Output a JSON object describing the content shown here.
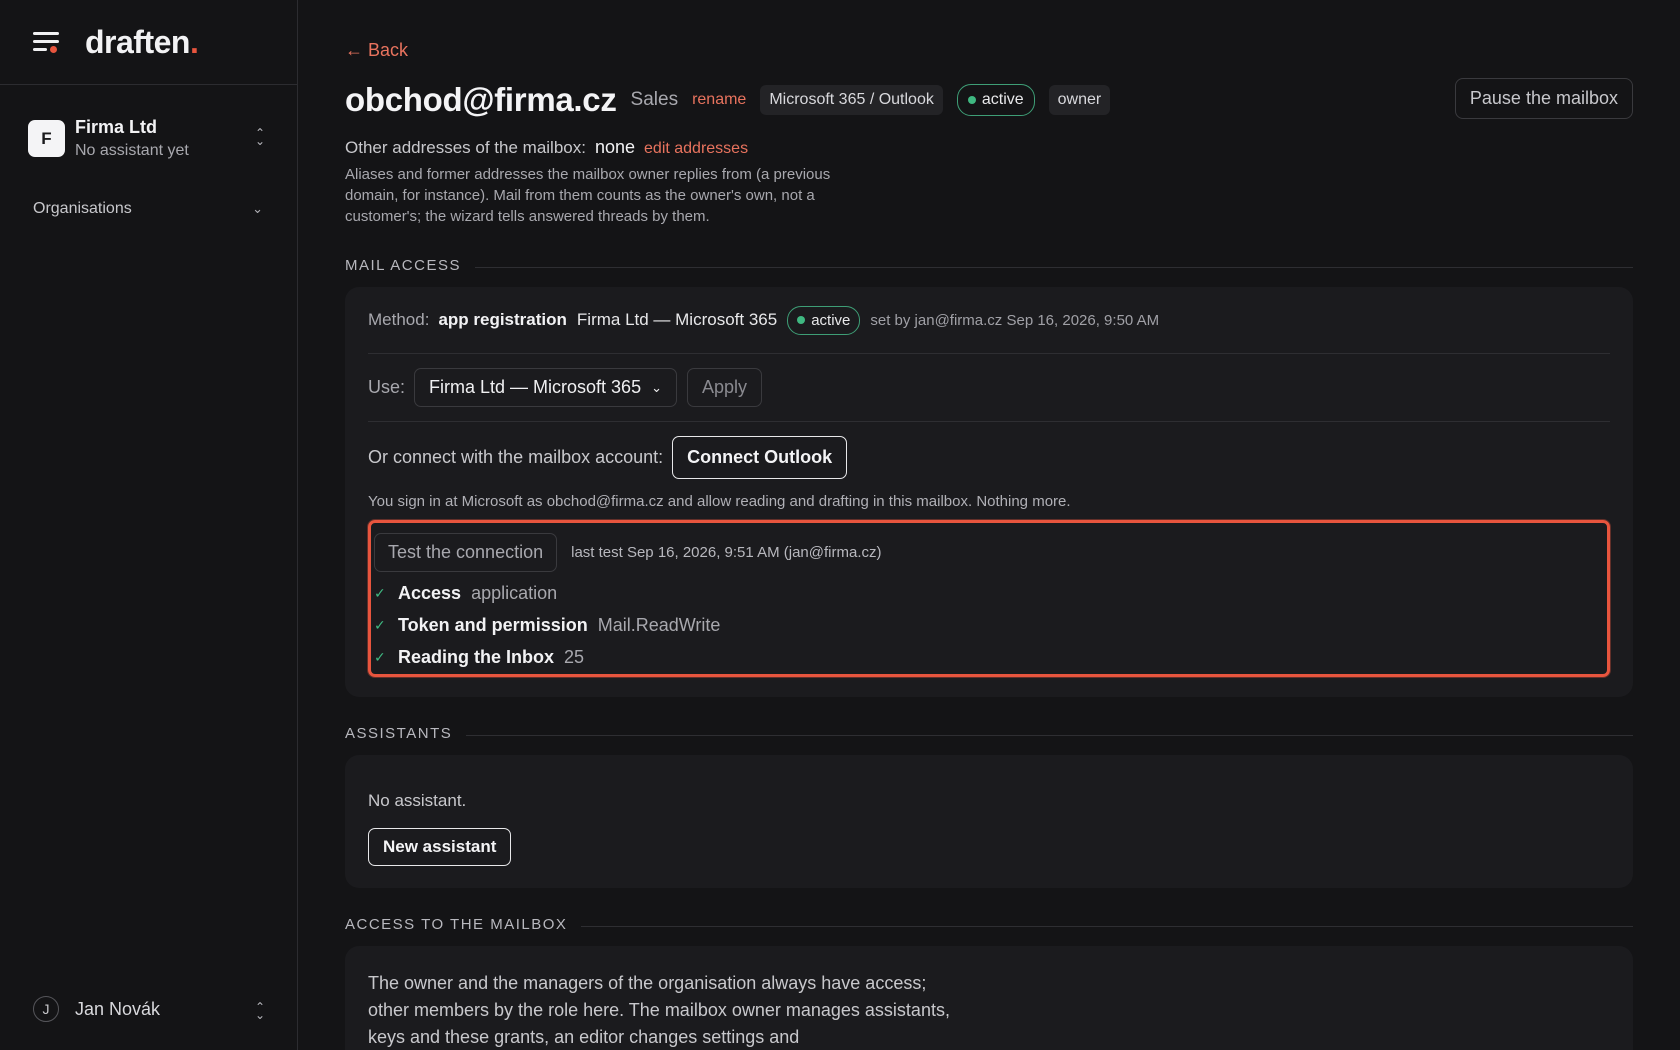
{
  "sidebar": {
    "logo": "draften",
    "logo_dot": ".",
    "org": {
      "initial": "F",
      "name": "Firma Ltd",
      "subtitle": "No assistant yet"
    },
    "organisations_label": "Organisations",
    "user": {
      "initial": "J",
      "name": "Jan Novák"
    }
  },
  "header": {
    "back_label": "← Back",
    "title": "obchod@firma.cz",
    "subtitle": "Sales",
    "rename_label": "rename",
    "provider_chip": "Microsoft 365 / Outlook",
    "status": "active",
    "role_chip": "owner",
    "pause_label": "Pause the mailbox"
  },
  "addresses": {
    "label": "Other addresses of the mailbox:",
    "value": "none",
    "edit_label": "edit addresses",
    "help": "Aliases and former addresses the mailbox owner replies from (a previous domain, for instance). Mail from them counts as the owner's own, not a customer's; the wizard tells answered threads by them."
  },
  "mail_access": {
    "heading": "MAIL ACCESS",
    "method_label": "Method:",
    "method_value": "app registration",
    "method_org": "Firma Ltd — Microsoft 365",
    "method_status": "active",
    "method_meta": "set by jan@firma.cz Sep 16, 2026, 9:50 AM",
    "use_label": "Use:",
    "use_selected": "Firma Ltd — Microsoft 365",
    "apply_label": "Apply",
    "connect_label": "Or connect with the mailbox account:",
    "connect_button": "Connect Outlook",
    "connect_help": "You sign in at Microsoft as obchod@firma.cz and allow reading and drafting in this mailbox. Nothing more.",
    "test_button": "Test the connection",
    "last_test": "last test Sep 16, 2026, 9:51 AM (jan@firma.cz)",
    "checks": [
      {
        "label": "Access",
        "value": "application"
      },
      {
        "label": "Token and permission",
        "value": "Mail.ReadWrite"
      },
      {
        "label": "Reading the Inbox",
        "value": "25"
      }
    ]
  },
  "assistants": {
    "heading": "ASSISTANTS",
    "empty_text": "No assistant.",
    "new_button": "New assistant"
  },
  "access": {
    "heading": "ACCESS TO THE MAILBOX",
    "text": "The owner and the managers of the organisation always have access; other members by the role here. The mailbox owner manages assistants, keys and these grants, an editor changes settings and"
  },
  "colors": {
    "accent": "#e8553e",
    "link": "#e8735e",
    "success": "#3fb881",
    "background": "#141416",
    "card": "#1b1b1e"
  }
}
